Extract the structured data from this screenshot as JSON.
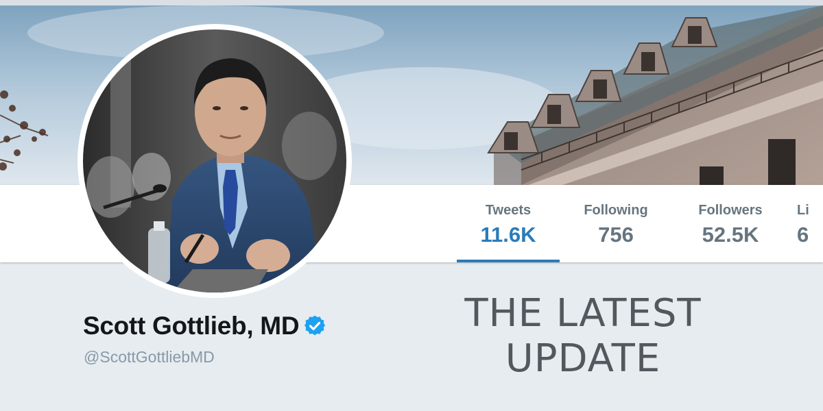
{
  "profile": {
    "name": "Scott Gottlieb, MD",
    "handle": "@ScottGottliebMD",
    "verified": true,
    "verified_icon": "verified-badge-icon"
  },
  "stats": [
    {
      "label": "Tweets",
      "value": "11.6K",
      "active": true
    },
    {
      "label": "Following",
      "value": "756",
      "active": false
    },
    {
      "label": "Followers",
      "value": "52.5K",
      "active": false
    },
    {
      "label": "Li",
      "value": "6",
      "active": false
    }
  ],
  "caption": {
    "line1": "THE LATEST",
    "line2": "UPDATE"
  },
  "colors": {
    "accent": "#2b7bb9",
    "stat_inactive": "#66757f",
    "page_background": "#e6ecf0",
    "verified_blue": "#1da1f2"
  }
}
